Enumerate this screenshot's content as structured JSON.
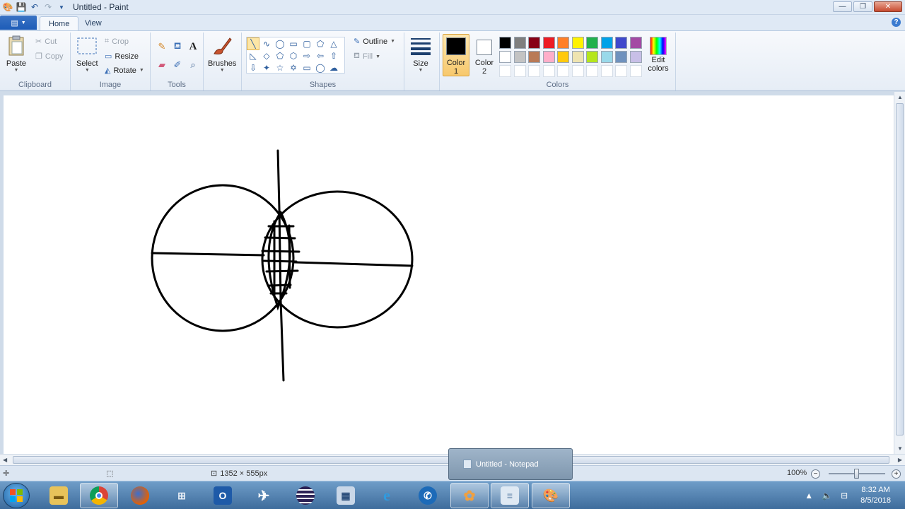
{
  "window": {
    "title": "Untitled - Paint",
    "controls": {
      "minimize": "—",
      "maximize": "❐",
      "close": "✕"
    }
  },
  "tabs": [
    {
      "label": "Home",
      "active": true
    },
    {
      "label": "View",
      "active": false
    }
  ],
  "ribbon": {
    "clipboard": {
      "group_label": "Clipboard",
      "paste": "Paste",
      "cut": "Cut",
      "copy": "Copy"
    },
    "image": {
      "group_label": "Image",
      "select": "Select",
      "crop": "Crop",
      "resize": "Resize",
      "rotate": "Rotate"
    },
    "tools": {
      "group_label": "Tools"
    },
    "brushes": {
      "label": "Brushes"
    },
    "shapes": {
      "group_label": "Shapes",
      "outline": "Outline",
      "fill": "Fill"
    },
    "size": {
      "label": "Size"
    },
    "colors": {
      "group_label": "Colors",
      "color1_label": "Color",
      "color1_num": "1",
      "color2_label": "Color",
      "color2_num": "2",
      "color1_value": "#000000",
      "color2_value": "#ffffff",
      "edit_colors_line1": "Edit",
      "edit_colors_line2": "colors",
      "palette_row1": [
        "#000000",
        "#7f7f7f",
        "#880015",
        "#ed1c24",
        "#ff7f27",
        "#fff200",
        "#22b14c",
        "#00a2e8",
        "#3f48cc",
        "#a349a4"
      ],
      "palette_row2": [
        "#ffffff",
        "#c3c3c3",
        "#b97a57",
        "#ffaec9",
        "#ffc90e",
        "#efe4b0",
        "#b5e61d",
        "#99d9ea",
        "#7092be",
        "#c8bfe7"
      ]
    }
  },
  "status": {
    "canvas_size": "1352 × 555px",
    "zoom": "100%"
  },
  "taskbar": {
    "apps": [
      "windows-explorer",
      "chrome",
      "firefox",
      "network-tool",
      "outlook",
      "airplane-app",
      "eclipse",
      "calculator",
      "internet-explorer",
      "phone-app",
      "flower-app",
      "notepad",
      "paint"
    ],
    "notepad_popup": "Untitled - Notepad",
    "time": "8:32 AM",
    "date": "8/5/2018"
  }
}
